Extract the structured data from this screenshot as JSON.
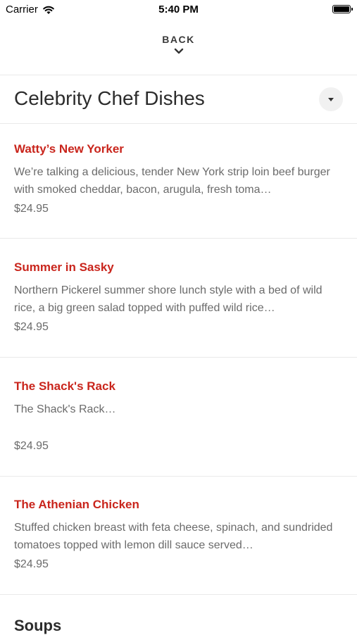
{
  "status_bar": {
    "carrier": "Carrier",
    "time": "5:40 PM"
  },
  "nav": {
    "back_label": "BACK"
  },
  "section": {
    "title": "Celebrity Chef Dishes",
    "items": [
      {
        "name": "Watty’s New Yorker",
        "description": "We’re talking a delicious, tender New York strip loin beef burger with smoked cheddar, bacon, arugula, fresh toma…",
        "price": "$24.95"
      },
      {
        "name": "Summer in Sasky",
        "description": "Northern Pickerel summer shore lunch style with a bed of wild rice, a big green salad topped with puffed wild rice…",
        "price": "$24.95"
      },
      {
        "name": "The Shack's Rack",
        "description": "The Shack's Rack…",
        "price": "$24.95"
      },
      {
        "name": "The Athenian Chicken",
        "description": "Stuffed chicken breast with feta cheese, spinach, and sundrided tomatoes topped with lemon dill sauce served…",
        "price": "$24.95"
      }
    ]
  },
  "next_section": {
    "title": "Soups"
  }
}
